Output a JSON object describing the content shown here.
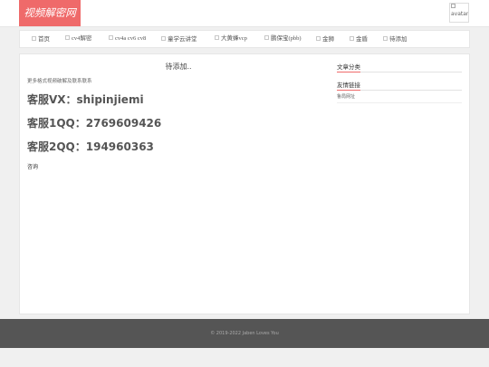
{
  "header": {
    "logo_text": "视频解密网",
    "avatar_alt": "avatar"
  },
  "nav": {
    "items": [
      {
        "label": "首页"
      },
      {
        "label": "cv4解密"
      },
      {
        "label": "cv4a cv6 cv8"
      },
      {
        "label": "童学云讲堂"
      },
      {
        "label": "大黄蜂vcp"
      },
      {
        "label": "鹏保宝(pbb)"
      },
      {
        "label": "金狮"
      },
      {
        "label": "金盾"
      },
      {
        "label": "待添加"
      }
    ]
  },
  "post": {
    "title": "待添加..",
    "intro": "更多格式视频破解及联系联系",
    "contacts": [
      "客服VX：shipinjiemi",
      "客服1QQ：2769609426",
      "客服2QQ：194960363"
    ],
    "link": "咨询"
  },
  "sidebar": {
    "categories_title": "文章分类",
    "links_title": "友情链接",
    "links": [
      "鲁局网址"
    ]
  },
  "footer": {
    "text": "© 2019-2022  Jaben Loves You"
  }
}
